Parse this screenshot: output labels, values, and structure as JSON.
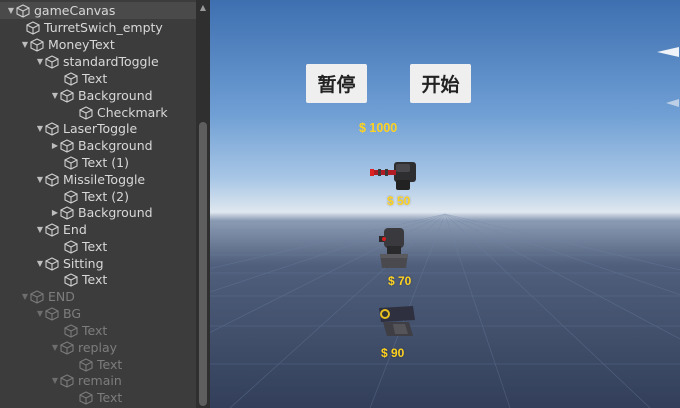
{
  "hierarchy": {
    "items": [
      {
        "label": "gameCanvas",
        "expanded": true,
        "disabled": false,
        "selected": true
      },
      {
        "label": "TurretSwich_empty",
        "expanded": null,
        "disabled": false
      },
      {
        "label": "MoneyText",
        "expanded": true,
        "disabled": false
      },
      {
        "label": "standardToggle",
        "expanded": true,
        "disabled": false
      },
      {
        "label": "Text",
        "expanded": null,
        "disabled": false
      },
      {
        "label": "Background",
        "expanded": true,
        "disabled": false
      },
      {
        "label": "Checkmark",
        "expanded": null,
        "disabled": false
      },
      {
        "label": "LaserToggle",
        "expanded": true,
        "disabled": false
      },
      {
        "label": "Background",
        "expanded": false,
        "disabled": false
      },
      {
        "label": "Text (1)",
        "expanded": null,
        "disabled": false
      },
      {
        "label": "MissileToggle",
        "expanded": true,
        "disabled": false
      },
      {
        "label": "Text (2)",
        "expanded": null,
        "disabled": false
      },
      {
        "label": "Background",
        "expanded": false,
        "disabled": false
      },
      {
        "label": "End",
        "expanded": true,
        "disabled": false
      },
      {
        "label": "Text",
        "expanded": null,
        "disabled": false
      },
      {
        "label": "Sitting",
        "expanded": true,
        "disabled": false
      },
      {
        "label": "Text",
        "expanded": null,
        "disabled": false
      },
      {
        "label": "END",
        "expanded": true,
        "disabled": true
      },
      {
        "label": "BG",
        "expanded": true,
        "disabled": true
      },
      {
        "label": "Text",
        "expanded": null,
        "disabled": true
      },
      {
        "label": "replay",
        "expanded": true,
        "disabled": true
      },
      {
        "label": "Text",
        "expanded": null,
        "disabled": true
      },
      {
        "label": "remain",
        "expanded": true,
        "disabled": true
      },
      {
        "label": "Text",
        "expanded": null,
        "disabled": true
      }
    ]
  },
  "game": {
    "pause_label": "暂停",
    "start_label": "开始",
    "money": "$ 1000",
    "turrets": [
      {
        "name": "standard",
        "price": "$ 50",
        "color": "#c0202a"
      },
      {
        "name": "laser",
        "price": "$ 70",
        "color": "#d02020"
      },
      {
        "name": "missile",
        "price": "$ 90",
        "color": "#e8c020"
      }
    ]
  },
  "colors": {
    "panel_bg": "#3c3c3c",
    "money_yellow": "#ffd21f",
    "button_bg": "#efefef"
  }
}
